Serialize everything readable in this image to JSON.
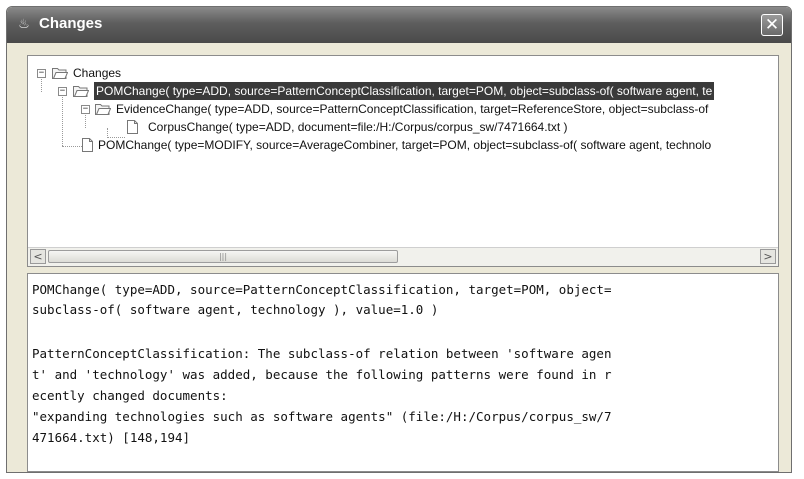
{
  "window": {
    "title": "Changes",
    "close_glyph": "✕",
    "app_icon": "java-cup-icon"
  },
  "tree": {
    "root_label": "Changes",
    "node1_label": "POMChange( type=ADD, source=PatternConceptClassification, target=POM, object=subclass-of( software agent, te",
    "node2_label": "EvidenceChange( type=ADD, source=PatternConceptClassification, target=ReferenceStore, object=subclass-of",
    "node3_label": "CorpusChange( type=ADD, document=file:/H:/Corpus/corpus_sw/7471664.txt )",
    "node4_label": "POMChange( type=MODIFY, source=AverageCombiner, target=POM, object=subclass-of( software agent, technolo",
    "expand_glyph": "−"
  },
  "scrollbar": {
    "left_glyph": "<",
    "right_glyph": ">",
    "thumb_grip": "|||"
  },
  "detail": {
    "line1": "POMChange( type=ADD, source=PatternConceptClassification, target=POM, object=",
    "line2": "subclass-of( software agent, technology ), value=1.0 )",
    "line3": "",
    "line4": "PatternConceptClassification: The subclass-of relation between 'software agen",
    "line5": "t' and 'technology' was added, because the following patterns were found in r",
    "line6": "ecently changed documents:",
    "line7": "\"expanding technologies such as software agents\" (file:/H:/Corpus/corpus_sw/7",
    "line8": "471664.txt) [148,194]"
  }
}
